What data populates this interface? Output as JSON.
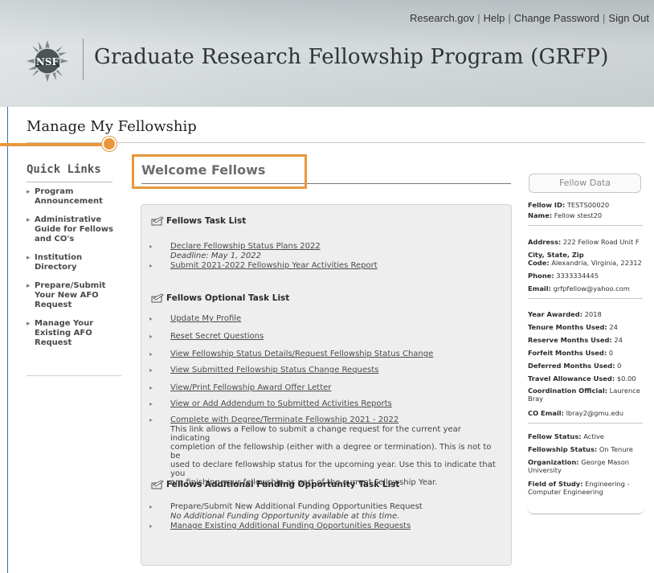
{
  "header": {
    "utility_links": [
      "Research.gov",
      "Help",
      "Change Password",
      "Sign Out"
    ],
    "logo_text": "NSF",
    "program_title": "Graduate Research Fellowship Program (GRFP)"
  },
  "page_title": "Manage My Fellowship",
  "quick_links": {
    "title": "Quick Links",
    "items": [
      {
        "lines": [
          "Program",
          "Announcement"
        ]
      },
      {
        "lines": [
          "Administrative",
          "Guide for Fellows",
          "and CO's"
        ]
      },
      {
        "lines": [
          "Institution",
          "Directory"
        ]
      },
      {
        "lines": [
          "Prepare/Submit",
          "Your New AFO",
          "Request"
        ]
      },
      {
        "lines": [
          "Manage Your",
          "Existing AFO",
          "Request"
        ]
      }
    ]
  },
  "welcome_title": "Welcome Fellows",
  "tasks": {
    "task_list_title": "Fellows Task List",
    "task_list": [
      {
        "label": "Declare Fellowship Status Plans 2022",
        "note": "Deadline: May 1, 2022"
      },
      {
        "label": "Submit 2021-2022 Fellowship Year Activities Report"
      }
    ],
    "optional_title": "Fellows Optional Task List",
    "optional": [
      "Update My Profile",
      "Reset Secret Questions",
      "View Fellowship Status Details/Request Fellowship Status Change",
      "View Submitted Fellowship Status Change Requests",
      "View/Print Fellowship Award Offer Letter",
      "View or Add Addendum to Submitted Activities Reports",
      "Complete with Degree/Terminate Fellowship 2021 - 2022"
    ],
    "complete_desc_lines": [
      "This link allows a Fellow to submit a change request for the current year indicating",
      "completion of the fellowship (either with a degree or termination). This is not to be",
      "used to declare fellowship status for the upcoming year. Use this to indicate that you",
      "are finishing your fellowship as part of the current Fellowship Year."
    ],
    "funding_title": "Fellows Additional Funding Opportunity Task List",
    "funding": [
      {
        "label": "Prepare/Submit New Additional Funding Opportunities Request",
        "note": "No Additional Funding Opportunity available at this time."
      },
      {
        "label": "Manage Existing Additional Funding Opportunities Requests"
      }
    ]
  },
  "fellow_data": {
    "title": "Fellow Data",
    "fellow_id": {
      "label": "Fellow ID:",
      "value": "TESTS00020"
    },
    "name": {
      "label": "Name:",
      "value": "Fellow stest20"
    },
    "address": {
      "label": "Address:",
      "value": "222 Fellow Road Unit F"
    },
    "city_label": "City, State, Zip",
    "code": {
      "label": "Code:",
      "value": "Alexandria, Virginia, 22312"
    },
    "phone": {
      "label": "Phone:",
      "value": "3333334445"
    },
    "email": {
      "label": "Email:",
      "value": "grfpfellow@yahoo.com"
    },
    "year_awarded": {
      "label": "Year Awarded:",
      "value": "2018"
    },
    "tenure_months": {
      "label": "Tenure Months Used:",
      "value": "24"
    },
    "reserve_months": {
      "label": "Reserve Months Used:",
      "value": "24"
    },
    "forfeit_months": {
      "label": "Forfeit Months Used:",
      "value": "0"
    },
    "deferred_months": {
      "label": "Deferred Months Used:",
      "value": "0"
    },
    "travel": {
      "label": "Travel Allowance Used:",
      "value": "$0.00"
    },
    "coordination_official": {
      "label": "Coordination Official:",
      "value_line1": "Laurence",
      "value_line2": "Bray"
    },
    "co_email": {
      "label": "CO Email:",
      "value": "lbray2@gmu.edu"
    },
    "fellow_status": {
      "label": "Fellow Status:",
      "value": "Active"
    },
    "fellowship_status": {
      "label": "Fellowship Status:",
      "value": "On Tenure"
    },
    "organization": {
      "label": "Organization:",
      "value_line1": "George Mason",
      "value_line2": "University"
    },
    "field": {
      "label": "Field of Study:",
      "value_line1": "Engineering -",
      "value_line2": "Computer Engineering"
    }
  },
  "colors": {
    "accent_orange": "#e8973c",
    "frame_blue": "#3d6fa0"
  }
}
